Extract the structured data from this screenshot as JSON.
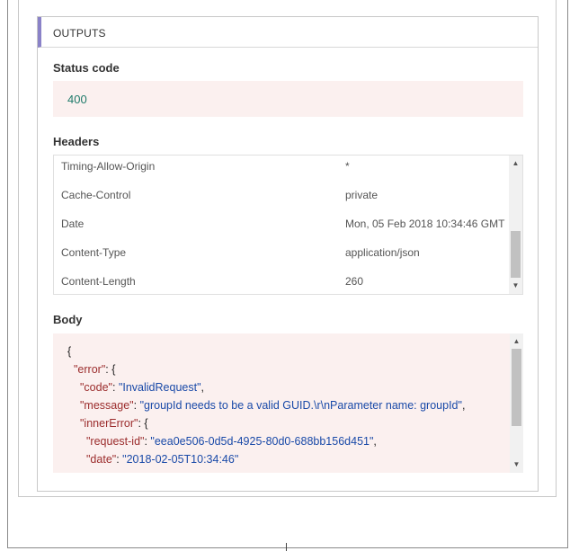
{
  "outputs": {
    "title": "OUTPUTS",
    "status_code": {
      "label": "Status code",
      "value": "400"
    },
    "headers": {
      "label": "Headers",
      "rows": [
        {
          "key": "Timing-Allow-Origin",
          "value": "*"
        },
        {
          "key": "Cache-Control",
          "value": "private"
        },
        {
          "key": "Date",
          "value": "Mon, 05 Feb 2018 10:34:46 GMT"
        },
        {
          "key": "Content-Type",
          "value": "application/json"
        },
        {
          "key": "Content-Length",
          "value": "260"
        }
      ]
    },
    "body": {
      "label": "Body",
      "lines": [
        {
          "open": "{"
        },
        {
          "key": "\"error\"",
          "sep": ": {"
        },
        {
          "key": "\"code\"",
          "sep": ": ",
          "val": "\"InvalidRequest\"",
          "end": ","
        },
        {
          "key": "\"message\"",
          "sep": ": ",
          "val": "\"groupId needs to be a valid GUID.\\r\\nParameter name: groupId\"",
          "end": ","
        },
        {
          "key": "\"innerError\"",
          "sep": ": {"
        },
        {
          "key": "\"request-id\"",
          "sep": ": ",
          "val": "\"eea0e506-0d5d-4925-80d0-688bb156d451\"",
          "end": ","
        },
        {
          "key": "\"date\"",
          "sep": ": ",
          "val": "\"2018-02-05T10:34:46\""
        }
      ]
    }
  },
  "icons": {
    "scroll_up": "▲",
    "scroll_down": "▼"
  }
}
